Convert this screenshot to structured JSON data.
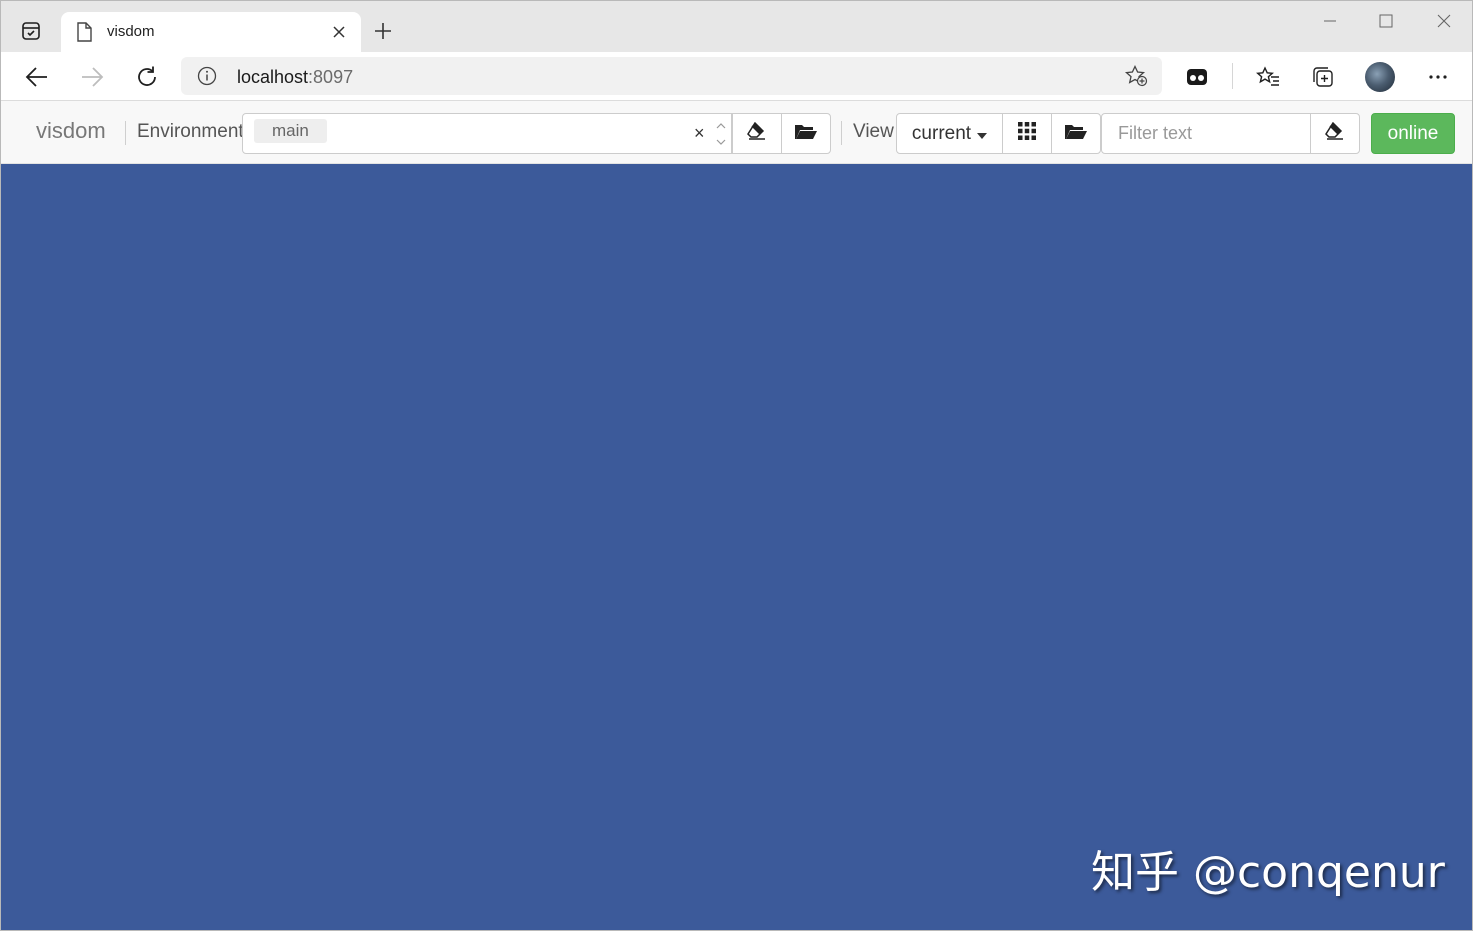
{
  "browser": {
    "tab_title": "visdom",
    "url_host": "localhost",
    "url_port": ":8097"
  },
  "visdom": {
    "brand": "visdom",
    "environment_label": "Environment",
    "environment_selected": "main",
    "clear_symbol": "×",
    "view_label": "View",
    "view_selected": "current",
    "filter_placeholder": "Filter text",
    "status": "online",
    "status_color": "#5cb85c"
  },
  "main": {
    "background_color": "#3c5a9a",
    "watermark": "知乎 @conqenur"
  },
  "icons": {
    "tab_actions": "tab-actions-icon",
    "page": "page-icon",
    "close": "close-icon",
    "new_tab": "plus-icon",
    "minimize": "minimize-icon",
    "maximize": "maximize-icon",
    "window_close": "window-close-icon",
    "back": "arrow-left-icon",
    "forward": "arrow-right-icon",
    "refresh": "refresh-icon",
    "site_info": "info-icon",
    "add_favorite": "star-add-icon",
    "extension": "extension-icon",
    "favorites": "favorites-icon",
    "collections": "collections-icon",
    "profile": "avatar",
    "menu": "more-icon",
    "eraser": "eraser-icon",
    "folder": "folder-open-icon",
    "grid": "grid-icon",
    "caret": "caret-down-icon"
  }
}
